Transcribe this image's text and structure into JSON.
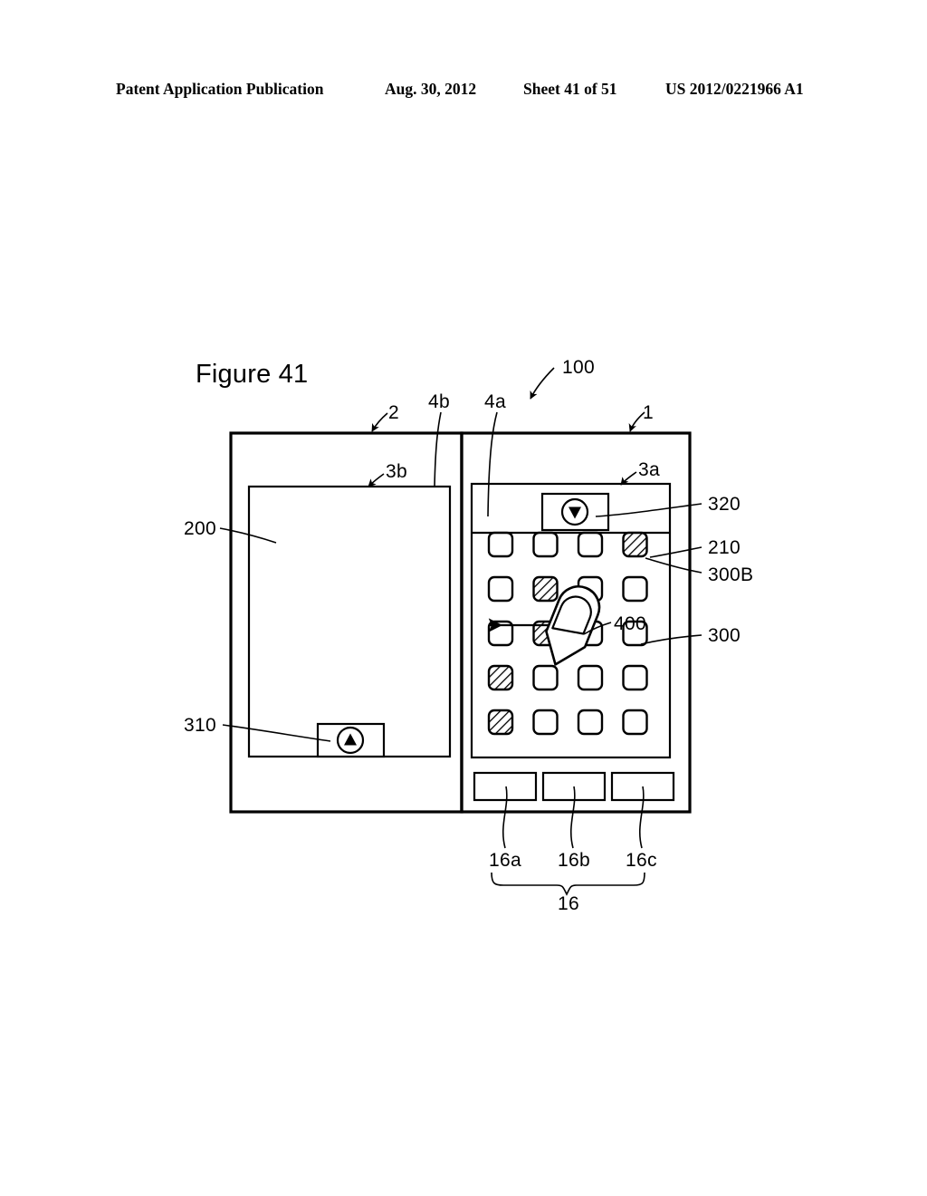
{
  "header": {
    "publication": "Patent Application Publication",
    "date": "Aug. 30, 2012",
    "sheet": "Sheet 41 of 51",
    "number": "US 2012/0221966 A1"
  },
  "figure": {
    "title": "Figure 41"
  },
  "labels": {
    "device": "100",
    "first_housing": "1",
    "second_housing": "2",
    "display_3a": "3a",
    "display_3b": "3b",
    "edge_4a": "4a",
    "edge_4b": "4b",
    "display_area_200": "200",
    "icon_area_210": "210",
    "icon_300": "300",
    "icon_300b": "300B",
    "button_310": "310",
    "button_320": "320",
    "finger_400": "400",
    "key_16a": "16a",
    "key_16b": "16b",
    "key_16c": "16c",
    "key_group_16": "16"
  },
  "icons": {
    "rows": 5,
    "cols": 4,
    "grid": [
      [
        "empty",
        "empty",
        "empty",
        "hatched"
      ],
      [
        "empty",
        "hatched",
        "empty",
        "empty"
      ],
      [
        "empty",
        "hatched",
        "empty",
        "empty"
      ],
      [
        "hatched",
        "empty",
        "empty",
        "empty"
      ],
      [
        "hatched",
        "empty",
        "empty",
        "empty"
      ]
    ]
  },
  "buttons": {
    "up_button_glyph": "triangle-up-in-circle",
    "down_button_glyph": "triangle-down-in-circle",
    "hardware_keys": [
      "16a",
      "16b",
      "16c"
    ]
  },
  "gesture": {
    "direction": "left",
    "pointer": "finger"
  },
  "colors": {
    "ink": "#000000",
    "paper": "#ffffff"
  }
}
